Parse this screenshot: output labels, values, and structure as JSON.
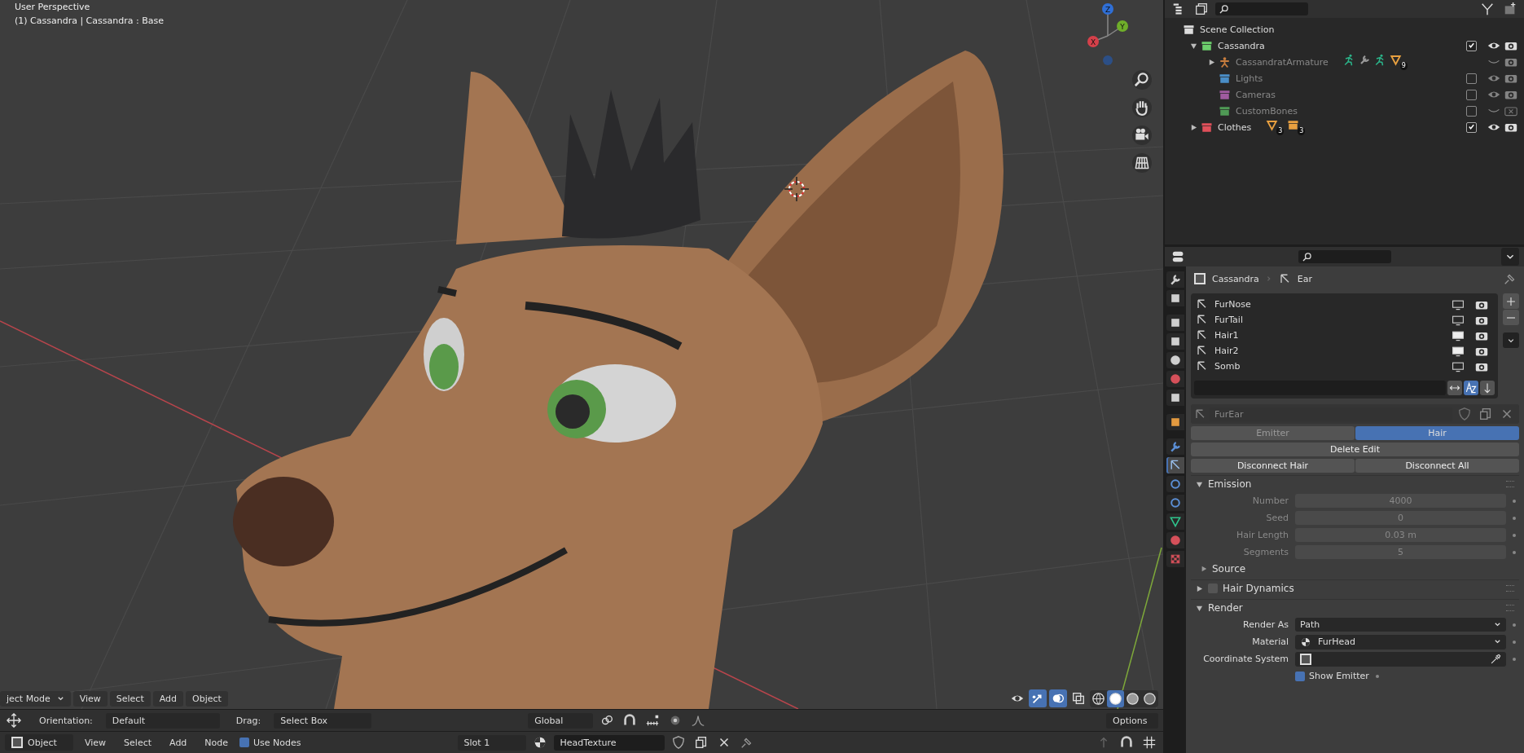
{
  "viewport": {
    "title": "User Perspective",
    "subtitle": "(1) Cassandra | Cassandra : Base",
    "gizmo_axes": [
      {
        "label": "Z",
        "color": "#2f6fd6"
      },
      {
        "label": "Y",
        "color": "#6fae2a"
      },
      {
        "label": "X",
        "color": "#d5404a"
      }
    ],
    "header_menus": [
      {
        "label": "ject Mode",
        "kind": "dropdown"
      },
      {
        "label": "View",
        "kind": "menu"
      },
      {
        "label": "Select",
        "kind": "menu"
      },
      {
        "label": "Add",
        "kind": "menu"
      },
      {
        "label": "Object",
        "kind": "menu"
      }
    ],
    "gizmos_on": true,
    "overlays_on": true,
    "shading_modes": [
      {
        "kind": "wireframe",
        "selected": false
      },
      {
        "kind": "solid",
        "selected": true
      },
      {
        "kind": "material",
        "selected": false
      },
      {
        "kind": "rendered",
        "selected": false
      }
    ]
  },
  "tool_settings": {
    "orientation_label": "Orientation:",
    "orientation": "Default",
    "drag_label": "Drag:",
    "drag": "Select Box",
    "transform_orientation": "Global",
    "snap_on": false,
    "proportional_on": false,
    "options": "Options"
  },
  "node_editor_header": {
    "mode": "Object",
    "menus": [
      "View",
      "Select",
      "Add",
      "Node"
    ],
    "use_nodes": {
      "label": "Use Nodes",
      "checked": true
    },
    "slot": "Slot 1",
    "material": "HeadTexture"
  },
  "outliner": {
    "items": [
      {
        "name": "Scene Collection",
        "kind": "scene",
        "children": [
          {
            "name": "Cassandra",
            "kind": "collection",
            "color": "#6ccf6c",
            "expanded": true,
            "checked": true,
            "visible": true,
            "renderable": true,
            "children": [
              {
                "name": "CassandratArmature",
                "kind": "armature",
                "expanded": false,
                "visible": false,
                "renderable": true,
                "badges": [
                  {
                    "kind": "pose"
                  },
                  {
                    "kind": "modifier"
                  },
                  {
                    "kind": "pose"
                  },
                  {
                    "kind": "mesh",
                    "count": "9"
                  }
                ]
              },
              {
                "name": "Lights",
                "kind": "collection",
                "color": "#4a8ec7",
                "checked": false,
                "visible": true,
                "renderable": true
              },
              {
                "name": "Cameras",
                "kind": "collection",
                "color": "#a05ba0",
                "checked": false,
                "visible": true,
                "renderable": true
              },
              {
                "name": "CustomBones",
                "kind": "collection",
                "color": "#4f9a55",
                "checked": false,
                "visible": false,
                "renderable": false
              }
            ]
          },
          {
            "name": "Clothes",
            "kind": "collection",
            "color": "#e0505a",
            "expanded": false,
            "checked": true,
            "visible": true,
            "renderable": true,
            "badges": [
              {
                "kind": "mesh",
                "count": "3"
              },
              {
                "kind": "collection",
                "count": "3"
              }
            ]
          }
        ]
      }
    ]
  },
  "properties": {
    "tabs": [
      {
        "kind": "tool",
        "selected": false
      },
      {
        "kind": "render",
        "selected": false
      },
      {
        "kind": "output",
        "selected": false
      },
      {
        "kind": "view-layer",
        "selected": false
      },
      {
        "kind": "scene",
        "selected": false
      },
      {
        "kind": "world",
        "selected": false
      },
      {
        "kind": "collection",
        "selected": false
      },
      {
        "kind": "object",
        "selected": false
      },
      {
        "kind": "modifier",
        "selected": false
      },
      {
        "kind": "particles",
        "selected": true
      },
      {
        "kind": "physics",
        "selected": false
      },
      {
        "kind": "constraints",
        "selected": false
      },
      {
        "kind": "data",
        "selected": false
      },
      {
        "kind": "material",
        "selected": false
      },
      {
        "kind": "texture",
        "selected": false
      }
    ],
    "breadcrumb": [
      "Cassandra",
      "Ear"
    ],
    "particle_systems": [
      {
        "name": "FurNose",
        "viewport": false
      },
      {
        "name": "FurTail",
        "viewport": false
      },
      {
        "name": "Hair1",
        "viewport": true
      },
      {
        "name": "Hair2",
        "viewport": true
      },
      {
        "name": "Somb",
        "viewport": false
      }
    ],
    "sort_alpha": true,
    "settings_name": "FurEar",
    "type_tabs": [
      {
        "label": "Emitter",
        "selected": false
      },
      {
        "label": "Hair",
        "selected": true
      }
    ],
    "buttons": [
      [
        "Delete Edit"
      ],
      [
        "Disconnect Hair",
        "Disconnect All"
      ]
    ],
    "panels": [
      {
        "title": "Emission",
        "expanded": true,
        "disabled": true,
        "fields": [
          {
            "label": "Number",
            "value": "4000",
            "kind": "number"
          },
          {
            "label": "Seed",
            "value": "0",
            "kind": "number"
          },
          {
            "label": "Hair Length",
            "value": "0.03 m",
            "kind": "number"
          },
          {
            "label": "Segments",
            "value": "5",
            "kind": "number"
          }
        ],
        "subpanels": [
          {
            "title": "Source",
            "expanded": false
          }
        ]
      },
      {
        "title": "Hair Dynamics",
        "expanded": false,
        "enabled": false
      },
      {
        "title": "Render",
        "expanded": true,
        "disabled": false,
        "fields": [
          {
            "label": "Render As",
            "value": "Path",
            "kind": "dropdown"
          },
          {
            "label": "Material",
            "value": "FurHead",
            "kind": "material"
          },
          {
            "label": "Coordinate System",
            "kind": "object"
          },
          {
            "label": "Show Emitter",
            "kind": "checkbox",
            "checked": true
          }
        ]
      }
    ]
  }
}
